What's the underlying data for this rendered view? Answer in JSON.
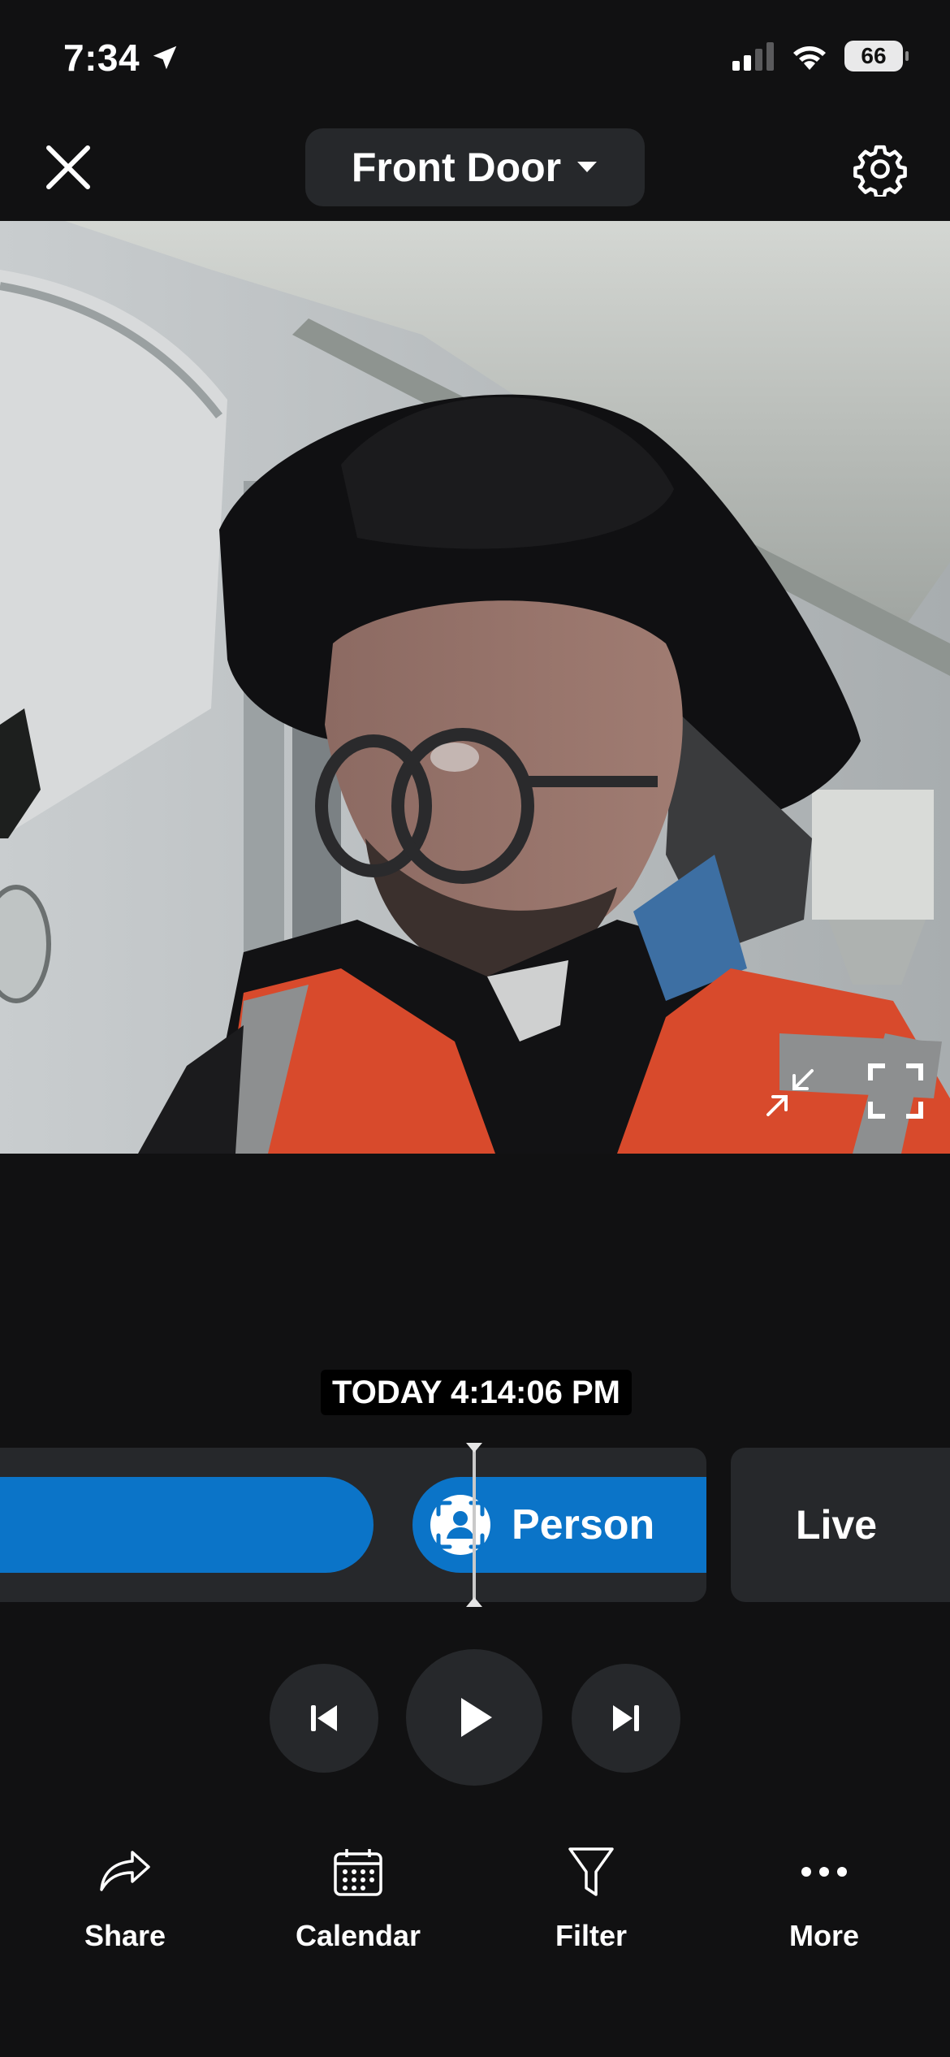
{
  "status_bar": {
    "time": "7:34",
    "battery": "66"
  },
  "header": {
    "camera_name": "Front Door"
  },
  "timeline": {
    "timestamp": "TODAY 4:14:06 PM",
    "event_label": "Person",
    "live_label": "Live"
  },
  "toolbar": {
    "share": "Share",
    "calendar": "Calendar",
    "filter": "Filter",
    "more": "More"
  },
  "icons": {
    "close": "close-icon",
    "dropdown": "chevron-down-icon",
    "settings": "gear-icon",
    "minimize": "minimize-icon",
    "fullscreen": "fullscreen-icon",
    "person": "person-icon",
    "previous": "skip-previous-icon",
    "play": "play-icon",
    "next": "skip-next-icon",
    "share": "share-icon",
    "calendar": "calendar-icon",
    "filter": "filter-icon",
    "more": "more-icon"
  },
  "colors": {
    "accent": "#0b74c8",
    "background": "#111112",
    "surface": "#26282b"
  }
}
